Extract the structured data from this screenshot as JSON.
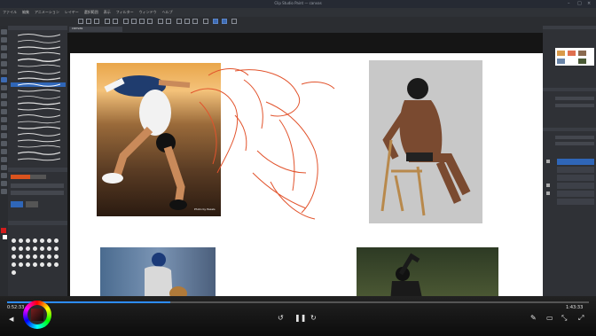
{
  "window": {
    "title": "Clip Studio Paint — canvas"
  },
  "menu": {
    "items": [
      "ファイル",
      "編集",
      "アニメーション",
      "レイヤー",
      "選択範囲",
      "表示",
      "フィルター",
      "ウィンドウ",
      "ヘルプ"
    ]
  },
  "canvas": {
    "tab_label": "canvas"
  },
  "photo_credit": {
    "text": "Photo by Pexels"
  },
  "player": {
    "time_current": "0:52:33",
    "time_total": "1:43:33",
    "progress": 0.28
  },
  "colors": {
    "accent": "#2d8cff",
    "sketch_stroke": "#e2532c",
    "selected_layer": "#2f66b8"
  }
}
